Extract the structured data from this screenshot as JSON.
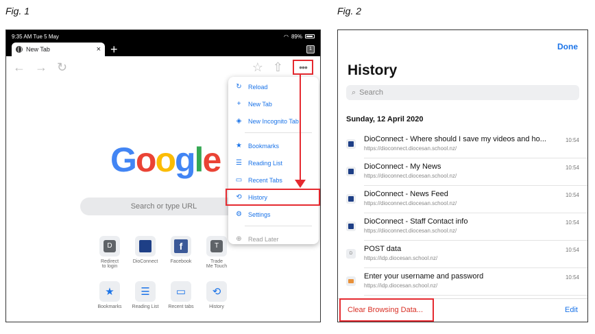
{
  "figures": {
    "fig1_label": "Fig. 1",
    "fig2_label": "Fig. 2"
  },
  "fig1": {
    "status": {
      "time": "9:35 AM  Tue 5 May",
      "battery": "89%"
    },
    "tab": {
      "title": "New Tab",
      "close": "×"
    },
    "new_tab_plus": "+",
    "tab_count": "1",
    "search_placeholder": "Search or type URL",
    "logo_letters": [
      {
        "ch": "G",
        "color": "#4285F4"
      },
      {
        "ch": "o",
        "color": "#EA4335"
      },
      {
        "ch": "o",
        "color": "#FBBC05"
      },
      {
        "ch": "g",
        "color": "#4285F4"
      },
      {
        "ch": "l",
        "color": "#34A853"
      },
      {
        "ch": "e",
        "color": "#EA4335"
      }
    ],
    "tiles_row1": [
      {
        "label1": "Redirect",
        "label2": "to login",
        "letter": "D"
      },
      {
        "label1": "DioConnect",
        "label2": ""
      },
      {
        "label1": "Facebook",
        "label2": ""
      },
      {
        "label1": "Trade",
        "label2": "Me Touch",
        "letter": "T"
      }
    ],
    "tiles_row2": [
      {
        "label": "Bookmarks",
        "glyph": "★"
      },
      {
        "label": "Reading List",
        "glyph": "☰"
      },
      {
        "label": "Recent tabs",
        "glyph": "▭"
      },
      {
        "label": "History",
        "glyph": "⟲"
      }
    ],
    "menu": {
      "group1": [
        {
          "label": "Reload",
          "glyph": "↻"
        },
        {
          "label": "New Tab",
          "glyph": "+"
        },
        {
          "label": "New Incognito Tab",
          "glyph": "◈"
        }
      ],
      "group2": [
        {
          "label": "Bookmarks",
          "glyph": "★"
        },
        {
          "label": "Reading List",
          "glyph": "☰"
        },
        {
          "label": "Recent Tabs",
          "glyph": "▭"
        },
        {
          "label": "History",
          "glyph": "⟲"
        },
        {
          "label": "Settings",
          "glyph": "⚙"
        }
      ],
      "group3": [
        {
          "label": "Read Later",
          "glyph": "⊕"
        }
      ]
    },
    "accent": "#1a73e8",
    "highlight": "#e5292f"
  },
  "fig2": {
    "done": "Done",
    "title": "History",
    "search_placeholder": "Search",
    "date": "Sunday, 12 April 2020",
    "rows": [
      {
        "title": "DioConnect - Where should I save my videos and ho...",
        "url": "https://dioconnect.diocesan.school.nz/",
        "time": "10:54",
        "fav": "dio"
      },
      {
        "title": "DioConnect - My News",
        "url": "https://dioconnect.diocesan.school.nz/",
        "time": "10:54",
        "fav": "dio"
      },
      {
        "title": "DioConnect - News Feed",
        "url": "https://dioconnect.diocesan.school.nz/",
        "time": "10:54",
        "fav": "dio"
      },
      {
        "title": "DioConnect - Staff Contact info",
        "url": "https://dioconnect.diocesan.school.nz/",
        "time": "10:54",
        "fav": "dio"
      },
      {
        "title": "POST data",
        "url": "https://idp.diocesan.school.nz/",
        "time": "10:54",
        "fav": "D"
      },
      {
        "title": "Enter your username and password",
        "url": "https://idp.diocesan.school.nz/",
        "time": "10:54",
        "fav": "orange"
      }
    ],
    "clear_label": "Clear Browsing Data...",
    "edit_label": "Edit"
  }
}
